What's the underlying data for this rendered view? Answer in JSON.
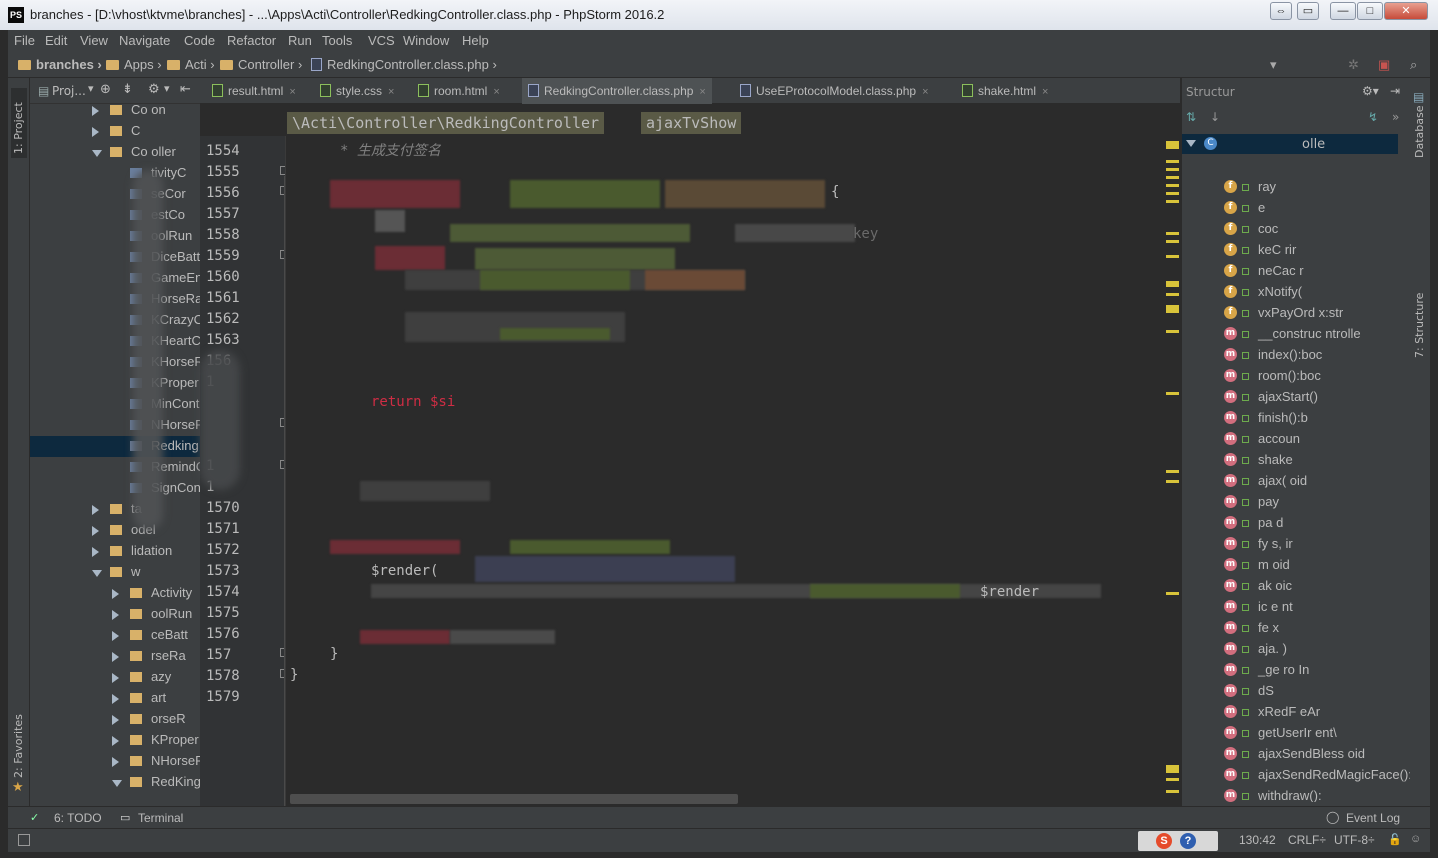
{
  "window": {
    "title": "branches - [D:\\vhost\\ktvme\\branches] - ...\\Apps\\Acti\\Controller\\RedkingController.class.php - PhpStorm 2016.2",
    "app_icon": "PS"
  },
  "menu": [
    "File",
    "Edit",
    "View",
    "Navigate",
    "Code",
    "Refactor",
    "Run",
    "Tools",
    "VCS",
    "Window",
    "Help"
  ],
  "breadcrumb": [
    "branches",
    "Apps",
    "Acti",
    "Controller",
    "RedkingController.class.php"
  ],
  "project_panel": {
    "header": "Proj...",
    "strip_label": "1: Project",
    "favorites_label": "2: Favorites",
    "items": [
      {
        "label": "Co on",
        "indent": 1,
        "arrow": "right"
      },
      {
        "label": "C",
        "indent": 1,
        "arrow": "right"
      },
      {
        "label": "Co oller",
        "indent": 1,
        "arrow": "down"
      },
      {
        "label": "tivityC",
        "indent": 2
      },
      {
        "label": "seCor",
        "indent": 2
      },
      {
        "label": "estCo",
        "indent": 2
      },
      {
        "label": "oolRun",
        "indent": 2
      },
      {
        "label": "DiceBatt",
        "indent": 2
      },
      {
        "label": "GameEn",
        "indent": 2
      },
      {
        "label": "HorseRa",
        "indent": 2
      },
      {
        "label": "KCrazyC",
        "indent": 2
      },
      {
        "label": "KHeartC",
        "indent": 2
      },
      {
        "label": "KHorseR",
        "indent": 2
      },
      {
        "label": "KProper",
        "indent": 2
      },
      {
        "label": "MinCont",
        "indent": 2
      },
      {
        "label": "NHorseF",
        "indent": 2
      },
      {
        "label": "Redking",
        "indent": 2,
        "selected": true
      },
      {
        "label": "RemindC",
        "indent": 2
      },
      {
        "label": "SignCon",
        "indent": 2
      },
      {
        "label": "ta",
        "indent": 1,
        "arrow": "right"
      },
      {
        "label": "odel",
        "indent": 1,
        "arrow": "right"
      },
      {
        "label": "lidation",
        "indent": 1,
        "arrow": "right"
      },
      {
        "label": "w",
        "indent": 1,
        "arrow": "down"
      },
      {
        "label": "Activity",
        "indent": 2,
        "arrow": "right"
      },
      {
        "label": "oolRun",
        "indent": 2,
        "arrow": "right"
      },
      {
        "label": "ceBatt",
        "indent": 2,
        "arrow": "right"
      },
      {
        "label": "rseRa",
        "indent": 2,
        "arrow": "right"
      },
      {
        "label": "azy",
        "indent": 2,
        "arrow": "right"
      },
      {
        "label": "art",
        "indent": 2,
        "arrow": "right"
      },
      {
        "label": "orseR",
        "indent": 2,
        "arrow": "right"
      },
      {
        "label": "KProper",
        "indent": 2,
        "arrow": "right"
      },
      {
        "label": "NHorseF",
        "indent": 2,
        "arrow": "right"
      },
      {
        "label": "RedKing",
        "indent": 2,
        "arrow": "down"
      }
    ]
  },
  "tabs": [
    {
      "label": "result.html",
      "active": false
    },
    {
      "label": "style.css",
      "active": false
    },
    {
      "label": "room.html",
      "active": false
    },
    {
      "label": "RedkingController.class.php",
      "active": true
    },
    {
      "label": "UseEProtocolModel.class.php",
      "active": false
    },
    {
      "label": "shake.html",
      "active": false
    }
  ],
  "editor_breadcrumb": {
    "path": "\\Acti\\Controller\\RedkingController",
    "method": "ajaxTvShow"
  },
  "line_numbers": [
    "1554",
    "1555",
    "1556",
    "1557",
    "1558",
    "1559",
    "1560",
    "1561",
    "1562",
    "1563",
    "156",
    "1",
    "",
    "",
    "",
    "1",
    "1",
    "1570",
    "1571",
    "1572",
    "1573",
    "1574",
    "1575",
    "1576",
    "157",
    "1578",
    "1579"
  ],
  "code": {
    "comment": "*  生成支付签名",
    "brace_open": "{",
    "key_fragment": "key",
    "return_fragment": "return $si",
    "render_fragment": "$render(",
    "render_fragment2": "$render",
    "brace_close_inner": "}",
    "brace_close_outer": "}"
  },
  "structure_panel": {
    "header": "Structur",
    "root": "olle",
    "items": [
      {
        "label": "ray",
        "kind": "field"
      },
      {
        "label": "e",
        "kind": "field"
      },
      {
        "label": "coc",
        "kind": "field"
      },
      {
        "label": "keC     rir",
        "kind": "field"
      },
      {
        "label": "neCac     r",
        "kind": "field"
      },
      {
        "label": "xNotify(",
        "kind": "field"
      },
      {
        "label": "vxPayOrd        x:str",
        "kind": "field"
      },
      {
        "label": "__construc       ntrolle",
        "kind": "method"
      },
      {
        "label": "index():boc",
        "kind": "method"
      },
      {
        "label": "room():boc",
        "kind": "method"
      },
      {
        "label": "ajaxStart()",
        "kind": "method"
      },
      {
        "label": "finish():b",
        "kind": "method"
      },
      {
        "label": "accoun",
        "kind": "method"
      },
      {
        "label": "shake",
        "kind": "method"
      },
      {
        "label": "ajax(          oid",
        "kind": "method"
      },
      {
        "label": "pay",
        "kind": "method"
      },
      {
        "label": "pa                d",
        "kind": "method"
      },
      {
        "label": "   fy        s, ir",
        "kind": "method"
      },
      {
        "label": "   m        oid",
        "kind": "method"
      },
      {
        "label": "   ak        oic",
        "kind": "method"
      },
      {
        "label": "   ic        e  nt",
        "kind": "method"
      },
      {
        "label": "fe   x",
        "kind": "method"
      },
      {
        "label": "aja.          )",
        "kind": "method"
      },
      {
        "label": "_ge        ro        In",
        "kind": "method"
      },
      {
        "label": "              dS",
        "kind": "method"
      },
      {
        "label": "xRedF          eAr",
        "kind": "method"
      },
      {
        "label": "getUserIr          ent\\",
        "kind": "method"
      },
      {
        "label": "ajaxSendBless      oid",
        "kind": "method"
      },
      {
        "label": "ajaxSendRedMagicFace():v",
        "kind": "method"
      },
      {
        "label": "withdraw():",
        "kind": "method"
      }
    ],
    "strip_label": "7: Structure",
    "db_label": "Database"
  },
  "bottom_tools": {
    "todo": "6: TODO",
    "terminal": "Terminal",
    "event_log": "Event Log"
  },
  "status": {
    "position": "130:42",
    "line_sep": "CRLF÷",
    "encoding": "UTF-8÷"
  },
  "colors": {
    "bg": "#2b2b2b",
    "panel": "#3c3f41",
    "selection": "#0d293e",
    "keyword": "#cc7832",
    "return": "#cf2d44",
    "comment": "#808080",
    "marker": "#d8c33a"
  }
}
